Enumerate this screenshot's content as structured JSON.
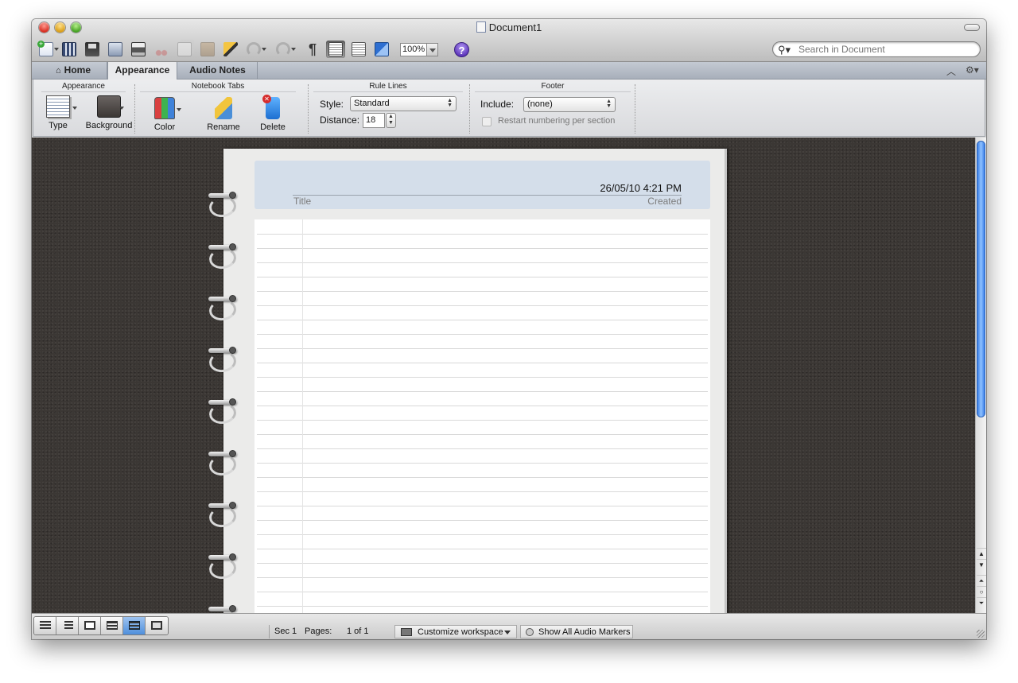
{
  "window": {
    "title": "Document1"
  },
  "toolbar": {
    "zoom_value": "100%",
    "help_label": "?",
    "search_placeholder": "Search in Document"
  },
  "tabs": [
    {
      "label": "Home"
    },
    {
      "label": "Appearance"
    },
    {
      "label": "Audio Notes"
    }
  ],
  "ribbon": {
    "appearance": {
      "title": "Appearance",
      "type_label": "Type",
      "background_label": "Background"
    },
    "notebook_tabs": {
      "title": "Notebook Tabs",
      "color_label": "Color",
      "rename_label": "Rename",
      "delete_label": "Delete"
    },
    "rule_lines": {
      "title": "Rule Lines",
      "style_label": "Style:",
      "style_value": "Standard",
      "distance_label": "Distance:",
      "distance_value": "18"
    },
    "footer": {
      "title": "Footer",
      "include_label": "Include:",
      "include_value": "(none)",
      "restart_label": "Restart numbering per section"
    }
  },
  "page": {
    "date": "26/05/10 4:21 PM",
    "title_label": "Title",
    "created_label": "Created"
  },
  "statusbar": {
    "section": "Sec 1",
    "pages_label": "Pages:",
    "pages_value": "1 of 1",
    "customize_label": "Customize workspace",
    "audio_markers_label": "Show All Audio Markers"
  },
  "colors": {
    "accent_blue": "#4f8fdc",
    "header_card": "#d4deea",
    "workspace_bg": "#3b3734"
  }
}
